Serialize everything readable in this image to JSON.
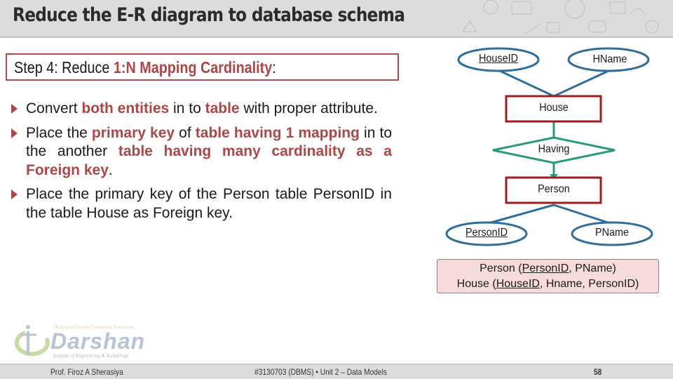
{
  "header": {
    "title": "Reduce the E-R diagram to database schema"
  },
  "step": {
    "prefix": "Step 4: Reduce ",
    "highlight": "1:N Mapping Cardinality",
    "suffix": ":"
  },
  "bullets": [
    {
      "segments": [
        {
          "text": "Convert ",
          "bold": false
        },
        {
          "text": "both entities",
          "bold": true
        },
        {
          "text": " in to ",
          "bold": false
        },
        {
          "text": "table",
          "bold": true
        },
        {
          "text": " with proper attribute.",
          "bold": false
        }
      ]
    },
    {
      "segments": [
        {
          "text": "Place the ",
          "bold": false
        },
        {
          "text": "primary key",
          "bold": true
        },
        {
          "text": " of ",
          "bold": false
        },
        {
          "text": "table having 1 mapping",
          "bold": true
        },
        {
          "text": " in to the another ",
          "bold": false
        },
        {
          "text": "table having many cardinality as a Foreign key",
          "bold": true
        },
        {
          "text": ".",
          "bold": false
        }
      ]
    },
    {
      "segments": [
        {
          "text": "Place the primary key of the Person table PersonID in the table House as Foreign key.",
          "bold": false
        }
      ]
    }
  ],
  "diagram": {
    "entities": [
      {
        "id": "house",
        "label": "House"
      },
      {
        "id": "person",
        "label": "Person"
      }
    ],
    "relationship": {
      "label": "Having"
    },
    "attributes": [
      {
        "id": "houseid",
        "label": "HouseID",
        "key": true
      },
      {
        "id": "hname",
        "label": "HName",
        "key": false
      },
      {
        "id": "personid",
        "label": "PersonID",
        "key": true
      },
      {
        "id": "pname",
        "label": "PName",
        "key": false
      }
    ],
    "colors": {
      "entity_border": "#a01c1c",
      "attribute_border": "#2d6e9e",
      "relationship_border": "#2a9a7e"
    }
  },
  "schema": {
    "person": {
      "name": "Person (",
      "key": "PersonID",
      "rest": ", PName)"
    },
    "house": {
      "name": "House (",
      "key": "HouseID",
      "rest": ", Hname, PersonID)"
    }
  },
  "logo": {
    "tagline": "Dedicated Faculty Committed Education",
    "name": "Darshan",
    "subtitle": "Institute of Engineering & Technology"
  },
  "footer": {
    "author": "Prof. Firoz A Sherasiya",
    "course": "#3130703 (DBMS)  •  Unit 2 – Data Models",
    "page": "58"
  },
  "colors": {
    "accent": "#b04545",
    "header_bg": "#dcdcdc",
    "schema_bg": "#f7dada"
  }
}
